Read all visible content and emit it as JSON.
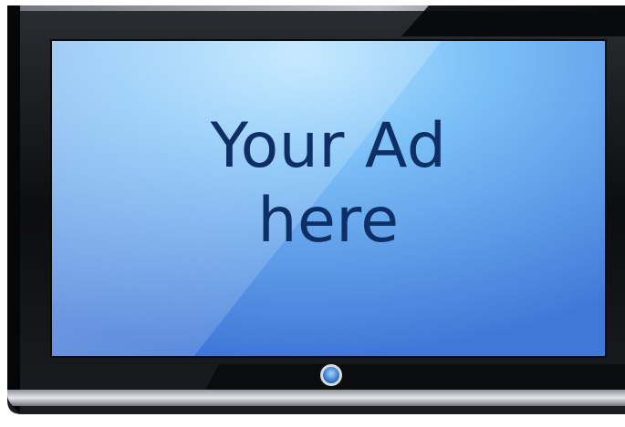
{
  "ad": {
    "line1": "Your Ad",
    "line2": "here"
  },
  "colors": {
    "bezel": "#121416",
    "bezel_highlight": "#4d5257",
    "screen_top": "#8fd0ff",
    "screen_bottom": "#4a86e3",
    "text": "#0e2f66",
    "power_button": "#2e78d2"
  },
  "icons": {
    "power_button": "power-button-icon"
  }
}
